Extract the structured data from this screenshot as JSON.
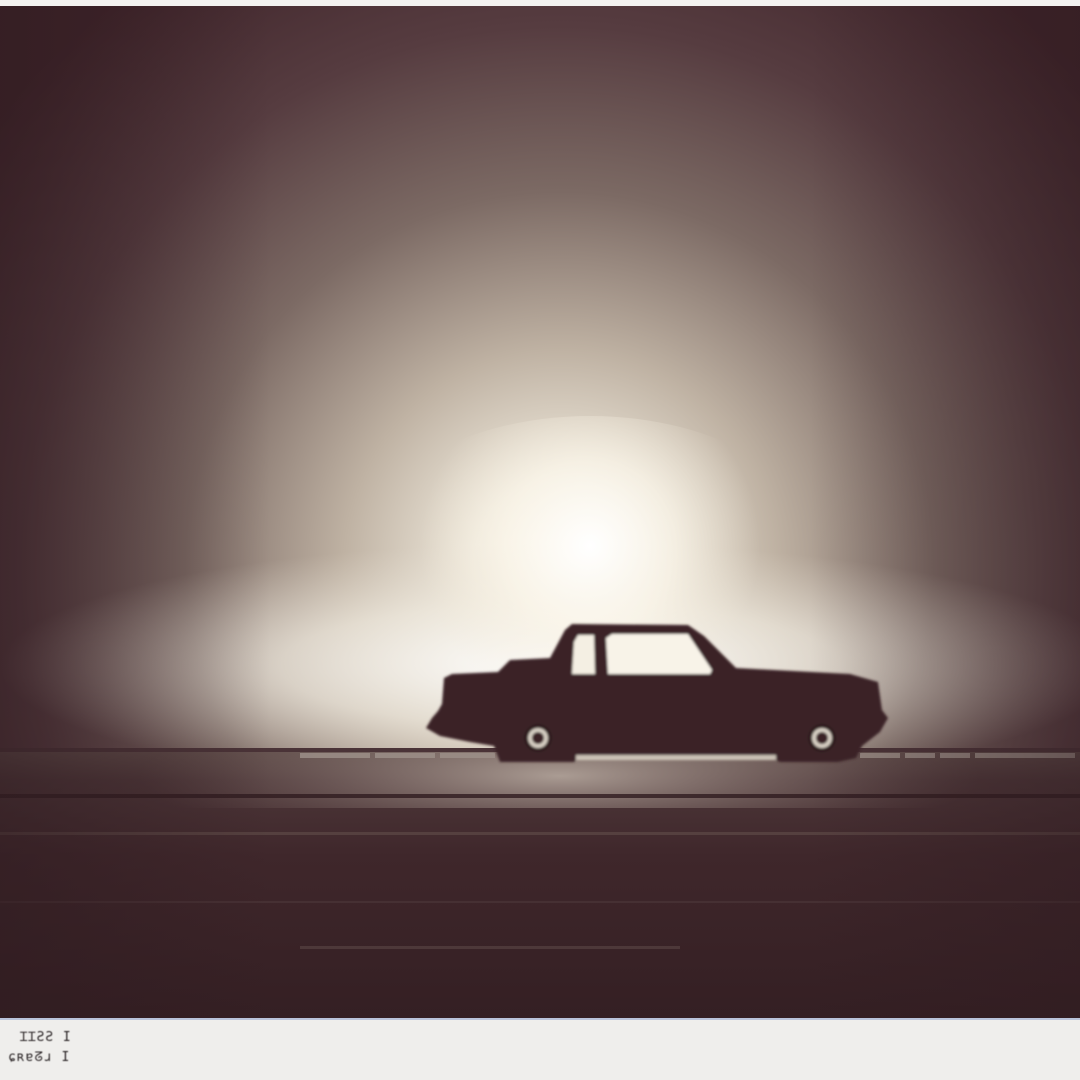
{
  "photo": {
    "subject": "car-silhouette",
    "colors": {
      "sky_dark": "#3f252b",
      "sky_mid": "#7a6a62",
      "glow_core": "#fbf7ec",
      "glow_warm": "#d9d1c1",
      "car": "#3a2326",
      "road_dark": "#3a2327",
      "road_light": "#6a5852",
      "print_border": "#efeeec",
      "border_line": "#b9c3da"
    }
  },
  "caption": {
    "line1": "ꞮꞮƧƧ I",
    "line2": "ɕʀɐᘔɹ I"
  }
}
